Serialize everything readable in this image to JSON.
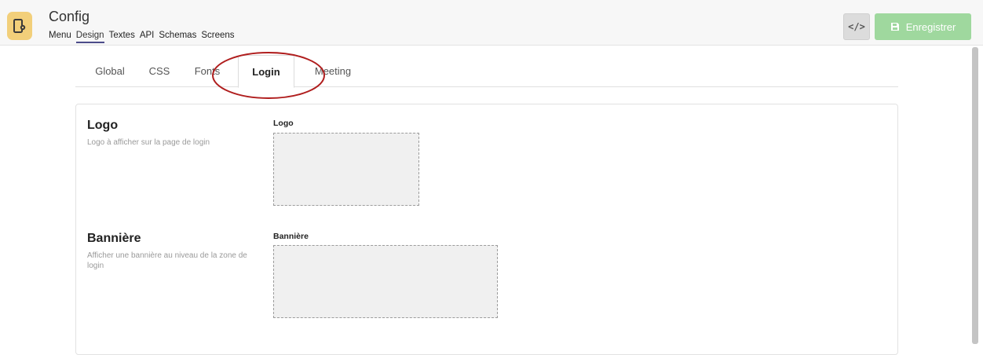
{
  "header": {
    "title": "Config",
    "nav": [
      {
        "label": "Menu",
        "active": false
      },
      {
        "label": "Design",
        "active": true
      },
      {
        "label": "Textes",
        "active": false
      },
      {
        "label": "API",
        "active": false
      },
      {
        "label": "Schemas",
        "active": false
      },
      {
        "label": "Screens",
        "active": false
      }
    ],
    "code_button_label": "</>",
    "save_label": "Enregistrer",
    "app_icon": "mobile-settings-icon",
    "save_icon": "floppy-disk-icon"
  },
  "tabs": [
    {
      "label": "Global",
      "active": false
    },
    {
      "label": "CSS",
      "active": false
    },
    {
      "label": "Fonts",
      "active": false
    },
    {
      "label": "Login",
      "active": true
    },
    {
      "label": "Meeting",
      "active": false
    }
  ],
  "sections": {
    "logo": {
      "title": "Logo",
      "description": "Logo à afficher sur la page de login",
      "field_label": "Logo"
    },
    "banner": {
      "title": "Bannière",
      "description": "Afficher une bannière au niveau de la zone de login",
      "field_label": "Bannière"
    }
  },
  "colors": {
    "accent": "#4c4c8a",
    "save_button": "#9fd89e",
    "app_icon": "#f2cf7a",
    "annotation": "#b01e1e"
  }
}
